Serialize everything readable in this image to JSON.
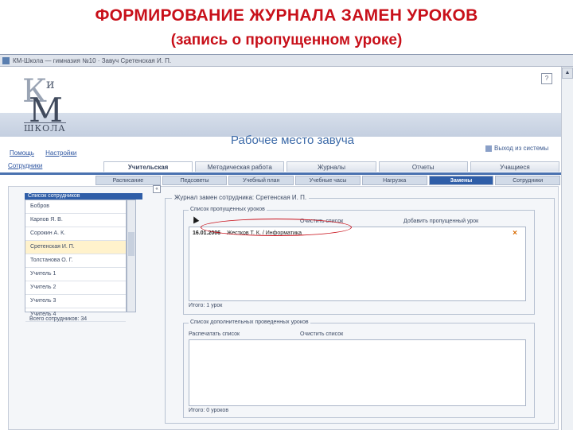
{
  "slide": {
    "title": "ФОРМИРОВАНИЕ ЖУРНАЛА ЗАМЕН УРОКОВ",
    "subtitle": "(запись о пропущенном уроке)"
  },
  "window": {
    "title": "КМ-Школа — гимназия №10 · Завуч Сретенская И. П."
  },
  "header": {
    "logo_letters": [
      "К",
      "и",
      "М"
    ],
    "logo_caption": "ШКОЛА",
    "workspace_title": "Рабочее место завуча",
    "exit_label": "Выход из системы"
  },
  "toplinks": [
    "Помощь",
    "Настройки"
  ],
  "left_label": "Сотрудники",
  "tabs_primary": [
    "Учительская",
    "Методическая работа",
    "Журналы",
    "Отчеты",
    "Учащиеся"
  ],
  "tabs_primary_active": "Учительская",
  "tabs_secondary": [
    "Расписание",
    "Педсоветы",
    "Учебный план",
    "Учебные часы",
    "Нагрузка",
    "Замены",
    "Сотрудники"
  ],
  "tabs_secondary_active": "Замены",
  "employees": {
    "header": "Список сотрудников",
    "items": [
      "Бобров",
      "Карпов Я. В.",
      "Сорокин А. К.",
      "Сретенская И. П.",
      "Толстанова О. Г.",
      "Учитель 1",
      "Учитель 2",
      "Учитель 3",
      "Учитель 4"
    ],
    "selected_index": 3,
    "footer": "Всего сотрудников: 34"
  },
  "journal": {
    "title": "Журнал замен сотрудника: Сретенская И. П.",
    "missed": {
      "title": "Список пропущенных уроков",
      "clear_link": "Очистить список",
      "add_link": "Добавить пропущенный урок",
      "row_date": "16.01.2006",
      "row_text": "Жестков Т. К. / Информатика",
      "footer": "Итого: 1 урок"
    },
    "extra": {
      "title": "Список дополнительных проведенных уроков",
      "print_link": "Распечатать список",
      "clear_link": "Очистить список",
      "footer": "Итого: 0 уроков"
    }
  },
  "colors": {
    "title_red": "#c8101a",
    "accent_blue": "#2f5ea8",
    "delete_orange": "#d86a00"
  }
}
